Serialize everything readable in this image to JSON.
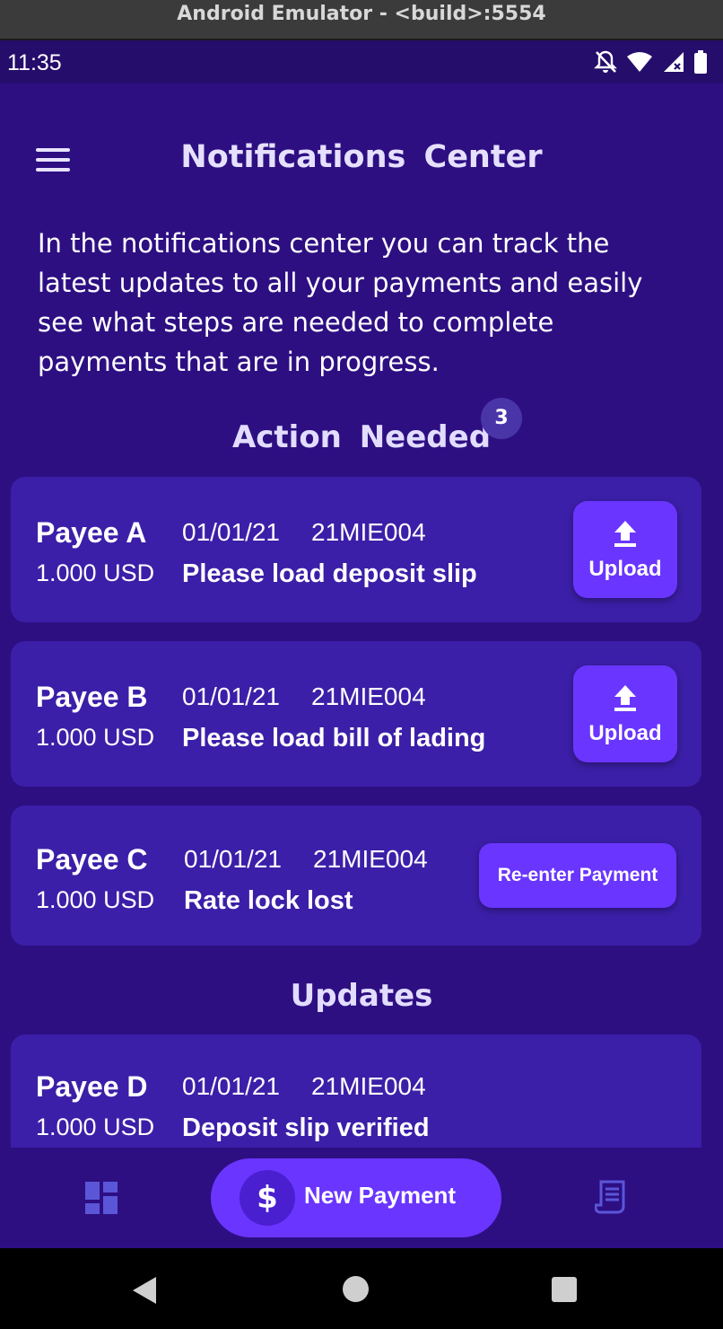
{
  "window": {
    "title": "Android Emulator - <build>:5554"
  },
  "status_bar": {
    "time": "11:35"
  },
  "header": {
    "title": "Notifications  Center"
  },
  "intro_text": "In the notifications center you can track the latest updates to all your payments and easily see what steps are needed to complete payments that are in progress.",
  "action_needed": {
    "title": "Action  Needed",
    "badge_count": "3",
    "items": [
      {
        "payee": "Payee A",
        "date": "01/01/21",
        "reference": "21MIE004",
        "amount": "1.000 USD",
        "message": "Please load deposit slip",
        "action": "Upload"
      },
      {
        "payee": "Payee B",
        "date": "01/01/21",
        "reference": "21MIE004",
        "amount": "1.000 USD",
        "message": "Please load bill of lading",
        "action": "Upload"
      },
      {
        "payee": "Payee C",
        "date": "01/01/21",
        "reference": "21MIE004",
        "amount": "1.000 USD",
        "message": "Rate lock lost",
        "action": "Re-enter Payment"
      }
    ]
  },
  "updates": {
    "title": "Updates",
    "items": [
      {
        "payee": "Payee D",
        "date": "01/01/21",
        "reference": "21MIE004",
        "amount": "1.000 USD",
        "message": "Deposit slip verified"
      }
    ]
  },
  "bottom_nav": {
    "left_icon": "dashboard-icon",
    "fab_label": "New Payment",
    "fab_icon": "dollar-icon",
    "right_icon": "receipt-icon"
  },
  "colors": {
    "background": "#2d0f82",
    "card": "#3b1fa8",
    "accent": "#6a35ff"
  }
}
